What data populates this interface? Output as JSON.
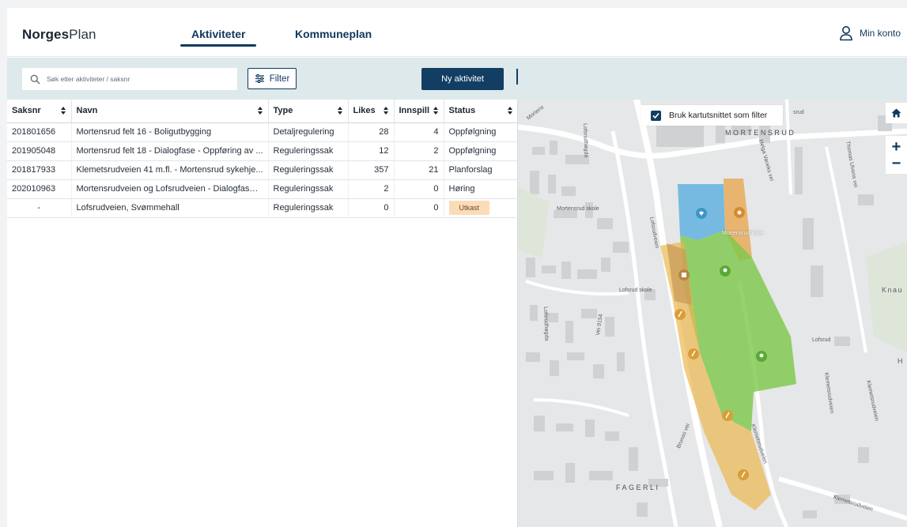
{
  "brand": {
    "bold": "Norges",
    "light": "Plan"
  },
  "nav": {
    "tabs": [
      {
        "label": "Aktiviteter",
        "active": true
      },
      {
        "label": "Kommuneplan",
        "active": false
      }
    ]
  },
  "account": {
    "label": "Min konto",
    "icon": "user-icon"
  },
  "toolbar": {
    "search_placeholder": "Søk etter aktiviteter / saksnr",
    "filter_label": "Filter",
    "new_label": "Ny aktivitet"
  },
  "table": {
    "columns": [
      "Saksnr",
      "Navn",
      "Type",
      "Likes",
      "Innspill",
      "Status"
    ],
    "rows": [
      {
        "saksnr": "201801656",
        "navn": "Mortensrud felt 16 - Boligutbygging",
        "type": "Detaljregulering",
        "likes": "28",
        "innspill": "4",
        "status": "Oppfølgning"
      },
      {
        "saksnr": "201905048",
        "navn": "Mortensrud felt 18 - Dialogfase - Oppføring av ...",
        "type": "Reguleringssak",
        "likes": "12",
        "innspill": "2",
        "status": "Oppfølgning"
      },
      {
        "saksnr": "201817933",
        "navn": "Klemetsrudveien 41 m.fl. - Mortensrud sykehje...",
        "type": "Reguleringssak",
        "likes": "357",
        "innspill": "21",
        "status": "Planforslag"
      },
      {
        "saksnr": "202010963",
        "navn": "Mortensrudveien og Lofsrudveien - Dialogfase ...",
        "type": "Reguleringssak",
        "likes": "2",
        "innspill": "0",
        "status": "Høring"
      },
      {
        "saksnr": "-",
        "navn": "Lofsrudveien, Svømmehall",
        "type": "Reguleringssak",
        "likes": "0",
        "innspill": "0",
        "status": "Utkast"
      }
    ]
  },
  "map": {
    "filter_label": "Bruk kartutsnittet som filter",
    "filter_checked": true,
    "controls": {
      "home": "home-icon",
      "zoom_in": "+",
      "zoom_out": "−"
    },
    "labels": {
      "mortensrud_skole": "Mortensrud skole",
      "mortensrud_kirke": "Mortensrud kirke",
      "lofsrud_skole": "Lofsrud skole",
      "lofsrud": "Lofsrud",
      "fagerli": "FAGERLI",
      "mortensrud": "MORTENSRUD",
      "knau": "Knau",
      "h": "H",
      "helga": "Helga Vaneks vei",
      "thomas": "Thomas Ulvens vei",
      "klemetsrudveien": "Klemetsrudveien",
      "klemetsrudveien2": "Klemetsrudveien",
      "klemetsrudveien3": "Klemetsrudveien",
      "klemetsrudveien4": "Klemetsrudveien",
      "lofsrudveien": "Lofsrudveien",
      "lofsrudhogda": "Lofsrudhøgda",
      "lofsrudhogda2": "Lofsrudhøgda",
      "brunas": "Brunas vei",
      "vei9154": "Vei 9154",
      "mortens": "Mortens",
      "srud": "srud"
    },
    "colors": {
      "blue": "#5aafde",
      "orange": "#e8a44a",
      "green": "#7cc84a",
      "yellow": "#ebb84f"
    }
  }
}
